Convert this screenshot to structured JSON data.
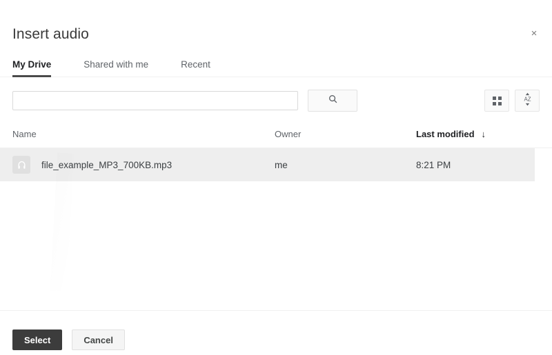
{
  "dialog": {
    "title": "Insert audio",
    "close_label": "×",
    "close_icon": "close-icon"
  },
  "tabs": [
    {
      "label": "My Drive",
      "active": true
    },
    {
      "label": "Shared with me",
      "active": false
    },
    {
      "label": "Recent",
      "active": false
    }
  ],
  "search": {
    "value": "",
    "placeholder": "",
    "button_icon": "search-icon"
  },
  "view_controls": [
    {
      "icon": "grid-view-icon",
      "label": ""
    },
    {
      "icon": "sort-az-icon",
      "label": "AZ"
    }
  ],
  "table": {
    "columns": [
      {
        "key": "name",
        "label": "Name",
        "sorted": false
      },
      {
        "key": "owner",
        "label": "Owner",
        "sorted": false
      },
      {
        "key": "modified",
        "label": "Last modified",
        "sorted": true,
        "sort_arrow": "↓"
      }
    ],
    "rows": [
      {
        "icon": "headphones-icon",
        "name": "file_example_MP3_700KB.mp3",
        "owner": "me",
        "modified": "8:21 PM",
        "selected": true
      }
    ]
  },
  "footer": {
    "select_label": "Select",
    "cancel_label": "Cancel"
  },
  "colors": {
    "primary_button": "#3c3c3c",
    "selected_row": "#eeeeee",
    "active_tab_underline": "#4a4a4a",
    "text": "#3c4043",
    "muted_text": "#5f6368"
  }
}
